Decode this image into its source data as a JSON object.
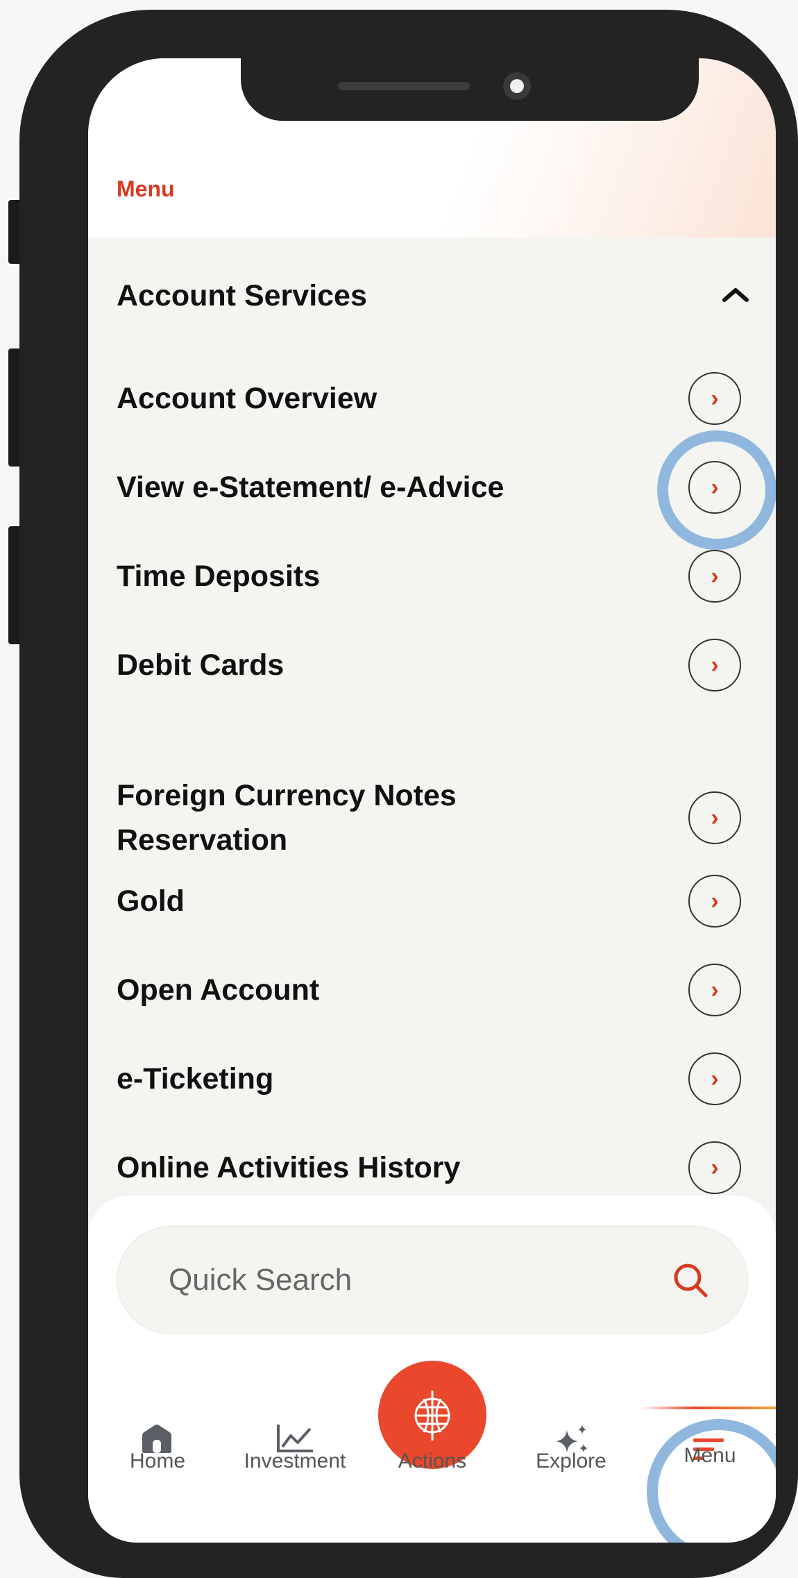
{
  "header": {
    "title": "Menu"
  },
  "section": {
    "title": "Account Services",
    "collapse_icon": "chevron-up-icon"
  },
  "items": [
    {
      "label": "Account Overview"
    },
    {
      "label": "View e-Statement/ e-Advice"
    },
    {
      "label": "Time Deposits"
    },
    {
      "label": "Debit Cards"
    },
    {
      "label": "Foreign Currency Notes Reservation"
    },
    {
      "label": "Gold"
    },
    {
      "label": "Open Account"
    },
    {
      "label": "e-Ticketing"
    },
    {
      "label": "Online Activities History"
    }
  ],
  "search": {
    "placeholder": "Quick Search"
  },
  "nav": {
    "home": "Home",
    "investment": "Investment",
    "actions": "Actions",
    "explore": "Explore",
    "menu": "Menu"
  },
  "colors": {
    "accent": "#e9482c",
    "brand_red": "#d63a1f",
    "highlight": "#8ab4dd"
  }
}
